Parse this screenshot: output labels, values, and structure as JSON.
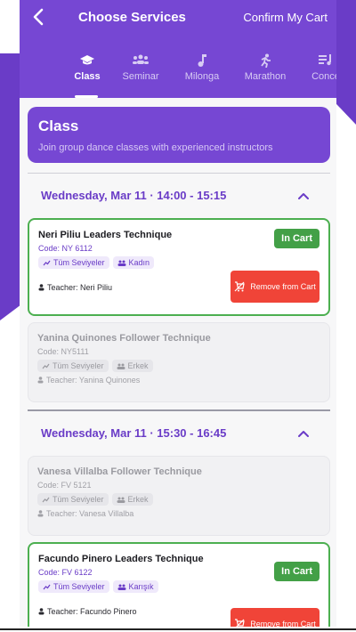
{
  "header": {
    "title": "Choose Services",
    "cart_link": "Confirm My Cart"
  },
  "tabs": [
    {
      "label": "Class",
      "icon": "graduation-cap-icon",
      "active": true
    },
    {
      "label": "Seminar",
      "icon": "group-icon",
      "active": false
    },
    {
      "label": "Milonga",
      "icon": "music-note-icon",
      "active": false
    },
    {
      "label": "Marathon",
      "icon": "runner-icon",
      "active": false
    },
    {
      "label": "Conce",
      "icon": "playlist-icon",
      "active": false
    }
  ],
  "banner": {
    "title": "Class",
    "subtitle": "Join group dance classes with experienced instructors"
  },
  "sessions": [
    {
      "heading": "Wednesday, Mar 11 · 14:00 - 15:15",
      "cards": [
        {
          "name": "Neri Piliu Leaders Technique",
          "code": "Code:  NY 6112",
          "level": "Tüm Seviyeler",
          "role": "Kadın",
          "teacher": "Teacher: Neri Piliu",
          "status": "In Cart",
          "action": "Remove from Cart"
        },
        {
          "name": "Yanina Quinones Follower Technique",
          "code": "Code:  NY5111",
          "level": "Tüm Seviyeler",
          "role": "Erkek",
          "teacher": "Teacher: Yanina Quinones"
        }
      ]
    },
    {
      "heading": "Wednesday, Mar 11 · 15:30 - 16:45",
      "cards": [
        {
          "name": "Vanesa Villalba Follower Technique",
          "code": "Code:  FV 5121",
          "level": "Tüm Seviyeler",
          "role": "Erkek",
          "teacher": "Teacher: Vanesa Villalba"
        },
        {
          "name": "Facundo Pinero Leaders Technique",
          "code": "Code:  FV 6122",
          "level": "Tüm Seviyeler",
          "role": "Karışık",
          "teacher": "Teacher: Facundo Pinero",
          "status": "In Cart",
          "action": "Remove from Cart"
        }
      ]
    }
  ],
  "colors": {
    "primary": "#7647d3",
    "in_cart": "#43a047",
    "remove": "#f04438"
  }
}
